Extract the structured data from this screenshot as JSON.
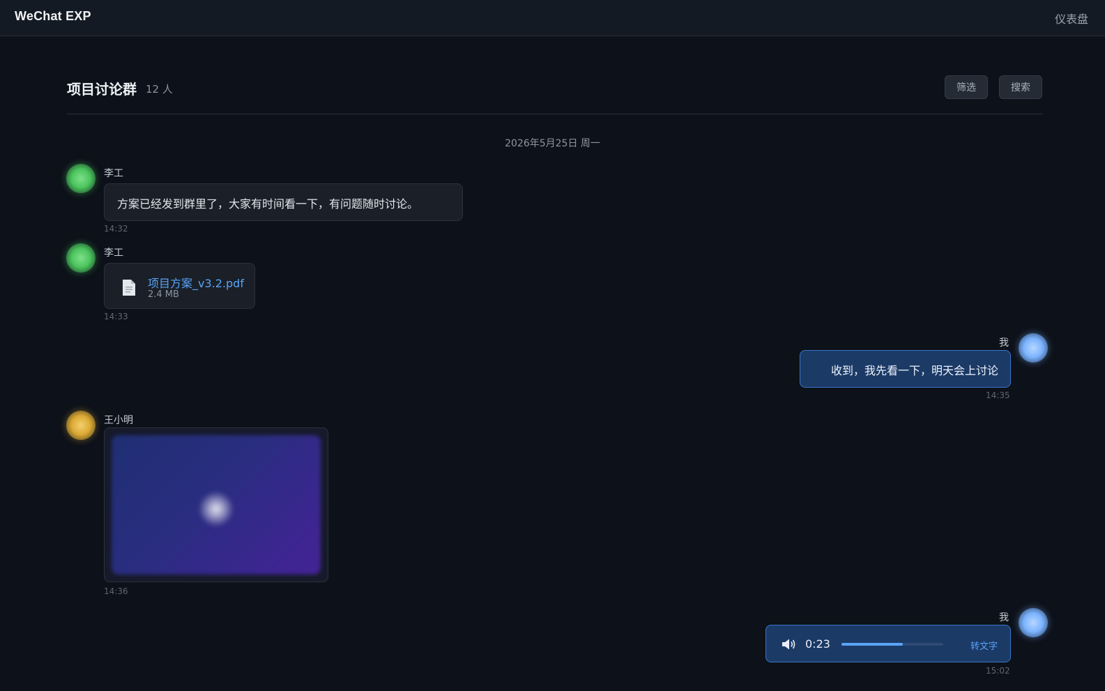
{
  "app": {
    "title": "WeChat EXP",
    "nav_link": "仪表盘"
  },
  "chat": {
    "group_name": "项目讨论群",
    "member_count": "12 人",
    "filter_label": "筛选",
    "search_label": "搜索",
    "date_separator": "2026年5月25日 周一"
  },
  "messages": [
    {
      "sender": "李工",
      "type": "text",
      "text": "方案已经发到群里了，大家有时间看一下，有问题随时讨论。",
      "time": "14:32",
      "avatar_color": "#4bc45d"
    },
    {
      "sender": "李工",
      "type": "file",
      "file_name": "项目方案_v3.2.pdf",
      "file_size": "2.4 MB",
      "icon": "document-icon",
      "time": "14:33",
      "avatar_color": "#4bc45d"
    },
    {
      "sender": "我",
      "type": "text",
      "text": "收到，我先看一下，明天会上讨论",
      "time": "14:35",
      "avatar_color": "#7cb4ff"
    },
    {
      "sender": "王小明",
      "type": "image",
      "time": "14:36",
      "avatar_color": "#dcaa34"
    },
    {
      "sender": "我",
      "type": "voice",
      "duration": "0:23",
      "progress": 0.6,
      "convert_label": "转文字",
      "icon": "speaker-icon",
      "time": "15:02",
      "avatar_color": "#7cb4ff"
    }
  ],
  "colors": {
    "accent": "#5aa4f7",
    "outgoing_bubble": "#1b3a66",
    "background": "#0d1119"
  }
}
